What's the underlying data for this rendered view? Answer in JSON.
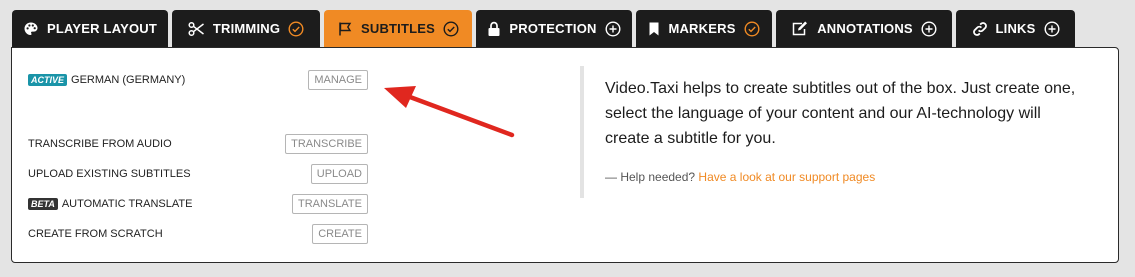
{
  "tabs": [
    {
      "label": "PLAYER LAYOUT",
      "icon": "palette-icon",
      "status": "none",
      "active": false
    },
    {
      "label": "TRIMMING",
      "icon": "scissors-icon",
      "status": "check",
      "active": false
    },
    {
      "label": "SUBTITLES",
      "icon": "flag-icon",
      "status": "check",
      "active": true
    },
    {
      "label": "PROTECTION",
      "icon": "lock-icon",
      "status": "plus",
      "active": false
    },
    {
      "label": "MARKERS",
      "icon": "bookmark-icon",
      "status": "check",
      "active": false
    },
    {
      "label": "ANNOTATIONS",
      "icon": "edit-icon",
      "status": "plus",
      "active": false
    },
    {
      "label": "LINKS",
      "icon": "link-icon",
      "status": "plus",
      "active": false
    }
  ],
  "subtitles": {
    "active_badge": "ACTIVE",
    "current_language": "GERMAN (GERMANY)",
    "manage_label": "MANAGE",
    "actions": [
      {
        "badge": "",
        "label": "TRANSCRIBE FROM AUDIO",
        "button": "TRANSCRIBE"
      },
      {
        "badge": "",
        "label": "UPLOAD EXISTING SUBTITLES",
        "button": "UPLOAD"
      },
      {
        "badge": "BETA",
        "label": "AUTOMATIC TRANSLATE",
        "button": "TRANSLATE"
      },
      {
        "badge": "",
        "label": "CREATE FROM SCRATCH",
        "button": "CREATE"
      }
    ]
  },
  "info": {
    "text": "Video.Taxi helps to create subtitles out of the box. Just create one, select the language of your content and our AI-technology will create a subtitle for you.",
    "help_prefix": "— Help needed?",
    "help_link": "Have a look at our support pages"
  },
  "colors": {
    "accent": "#f08a24",
    "tab_bg": "#1c1c1c",
    "active_badge": "#1a94a8",
    "arrow": "#e0271f"
  }
}
